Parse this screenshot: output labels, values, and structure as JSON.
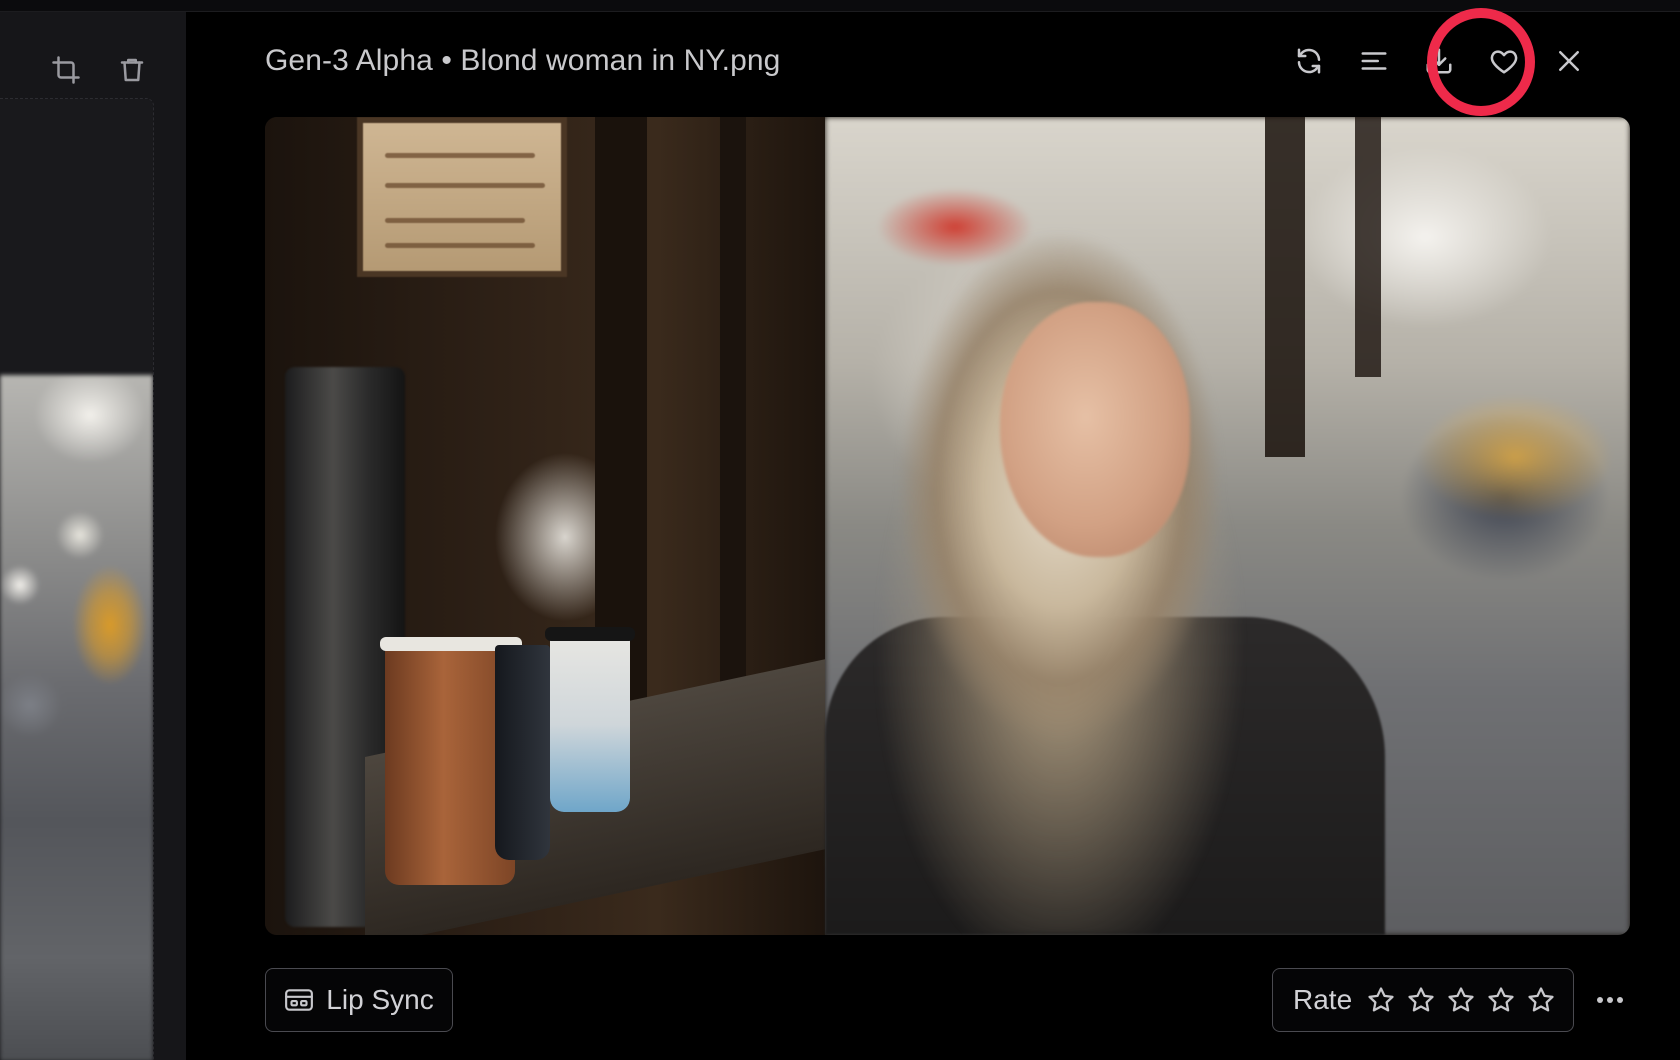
{
  "header": {
    "title": "Gen-3 Alpha • Blond woman in NY.png",
    "actions": [
      {
        "icon": "refresh-icon",
        "name": "regenerate-button"
      },
      {
        "icon": "menu-lines-icon",
        "name": "details-button"
      },
      {
        "icon": "download-icon",
        "name": "download-button"
      },
      {
        "icon": "heart-icon",
        "name": "favorite-button"
      },
      {
        "icon": "close-icon",
        "name": "close-button"
      }
    ]
  },
  "left_panel": {
    "tools": [
      {
        "icon": "crop-icon"
      },
      {
        "icon": "trash-icon"
      }
    ]
  },
  "image": {
    "description": "Blond woman in NY"
  },
  "footer": {
    "lip_sync_label": "Lip Sync",
    "rate_label": "Rate",
    "star_count": 5,
    "rating": 0
  },
  "colors": {
    "background": "#000000",
    "panel": "#161619",
    "highlight": "#ee2a4a",
    "text": "#c9c9cc"
  }
}
